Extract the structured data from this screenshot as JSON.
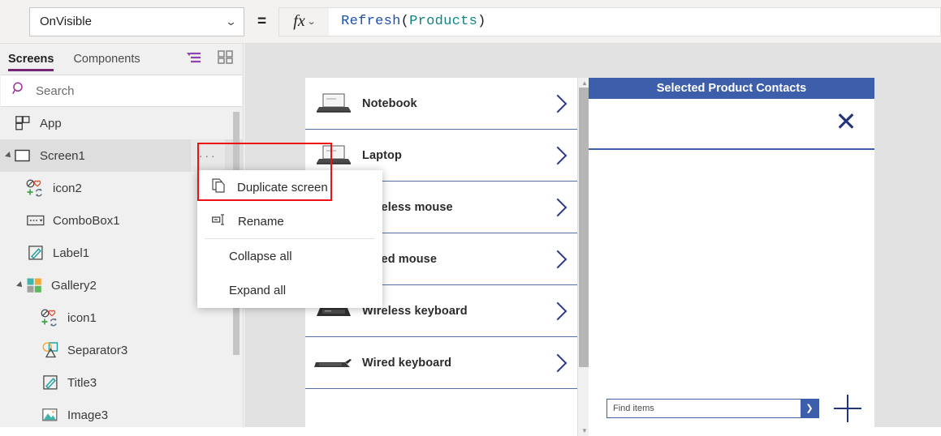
{
  "formula_bar": {
    "property": "OnVisible",
    "property_chevron": "chevron-down",
    "equals": "=",
    "fx_label": "fx",
    "formula_tokens": [
      {
        "text": "Refresh",
        "kind": "fn"
      },
      {
        "text": "( ",
        "kind": "punc"
      },
      {
        "text": "Products",
        "kind": "ident"
      },
      {
        "text": " )",
        "kind": "punc"
      }
    ],
    "formula_text": "Refresh( Products )"
  },
  "sidebar": {
    "tabs": [
      {
        "label": "Screens",
        "active": true
      },
      {
        "label": "Components",
        "active": false
      }
    ],
    "view_icons": [
      "tree-view-icon",
      "thumbnail-view-icon"
    ],
    "search": {
      "placeholder": "Search",
      "value": "",
      "icon": "search-icon"
    },
    "tree": [
      {
        "label": "App",
        "icon": "app-icon",
        "depth": 0,
        "caret": false,
        "selected": false
      },
      {
        "label": "Screen1",
        "icon": "screen-icon",
        "depth": 0,
        "caret": true,
        "selected": true
      },
      {
        "label": "icon2",
        "icon": "icon-control-icon",
        "depth": 1,
        "caret": false,
        "selected": false
      },
      {
        "label": "ComboBox1",
        "icon": "combobox-icon",
        "depth": 1,
        "caret": false,
        "selected": false
      },
      {
        "label": "Label1",
        "icon": "label-icon",
        "depth": 1,
        "caret": false,
        "selected": false
      },
      {
        "label": "Gallery2",
        "icon": "gallery-icon",
        "depth": 1,
        "caret": true,
        "selected": false
      },
      {
        "label": "icon1",
        "icon": "icon-control-icon",
        "depth": 2,
        "caret": false,
        "selected": false
      },
      {
        "label": "Separator3",
        "icon": "shapes-icon",
        "depth": 2,
        "caret": false,
        "selected": false
      },
      {
        "label": "Title3",
        "icon": "label-icon",
        "depth": 2,
        "caret": false,
        "selected": false
      },
      {
        "label": "Image3",
        "icon": "image-icon",
        "depth": 2,
        "caret": false,
        "selected": false
      }
    ],
    "ellipsis_label": "···"
  },
  "context_menu": {
    "items": [
      {
        "label": "Duplicate screen",
        "icon": "duplicate-icon"
      },
      {
        "label": "Rename",
        "icon": "rename-icon"
      },
      {
        "label": "Collapse all",
        "icon": null
      },
      {
        "label": "Expand all",
        "icon": null
      }
    ]
  },
  "canvas": {
    "gallery": {
      "items": [
        {
          "label": "Notebook",
          "thumb": "laptop-open-photo",
          "chevron": "chevron-right"
        },
        {
          "label": "Laptop",
          "thumb": "laptop-open-photo",
          "chevron": "chevron-right"
        },
        {
          "label": "Wireless mouse",
          "thumb": "mouse-photo",
          "chevron": "chevron-right"
        },
        {
          "label": "Wired mouse",
          "thumb": "mouse-photo",
          "chevron": "chevron-right"
        },
        {
          "label": "Wireless keyboard",
          "thumb": "keyboard-photo",
          "chevron": "chevron-right"
        },
        {
          "label": "Wired keyboard",
          "thumb": "keyboard-photo",
          "chevron": "chevron-right"
        }
      ]
    },
    "contacts_panel": {
      "title": "Selected Product Contacts",
      "close_icon": "close-icon",
      "find_combobox": {
        "placeholder": "Find items",
        "value": "",
        "arrow": "chevron-down"
      },
      "add_icon": "plus-icon"
    }
  },
  "colors": {
    "accent_purple": "#742774",
    "panel_blue": "#3d5fab",
    "highlight_red": "#ee1111",
    "formula_fn": "#1f4fa8",
    "formula_ident": "#118383"
  }
}
